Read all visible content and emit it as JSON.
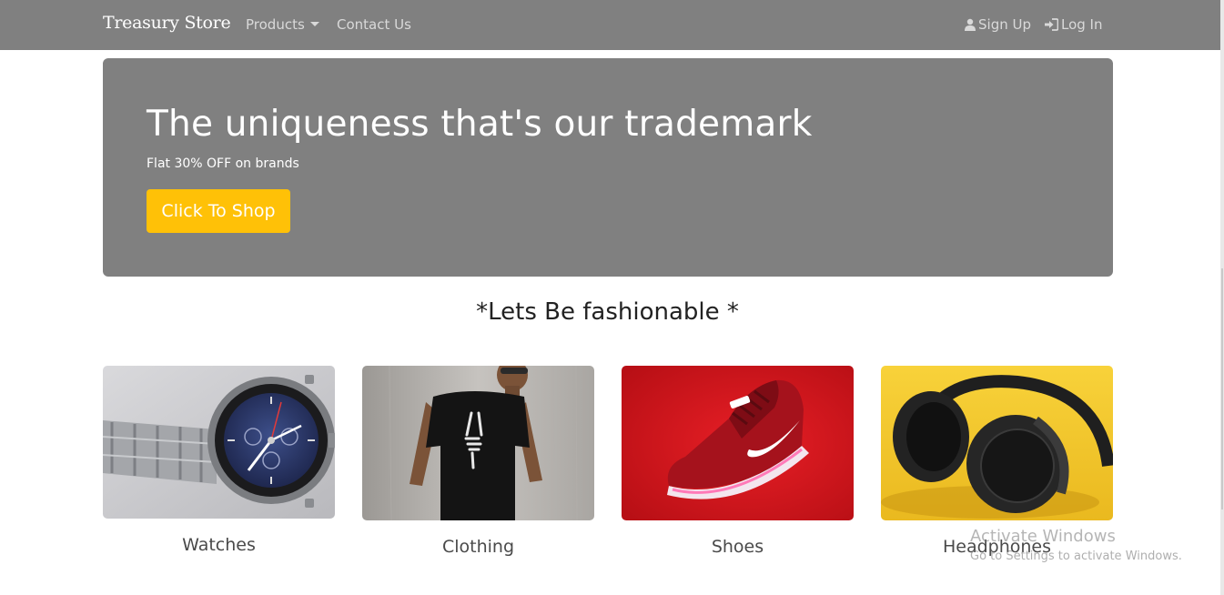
{
  "navbar": {
    "brand": "Treasury Store",
    "products_label": "Products",
    "contact_label": "Contact Us",
    "signup_label": "Sign Up",
    "login_label": "Log In"
  },
  "hero": {
    "title": "The uniqueness that's our trademark",
    "subtitle": "Flat 30% OFF on brands",
    "button_label": "Click To Shop"
  },
  "section": {
    "title": "*Lets Be fashionable *"
  },
  "categories": [
    {
      "label": "Watches",
      "image": "wristwatch-photo"
    },
    {
      "label": "Clothing",
      "image": "man-in-black-tshirt-photo"
    },
    {
      "label": "Shoes",
      "image": "red-sneaker-photo"
    },
    {
      "label": "Headphones",
      "image": "black-headphones-photo"
    }
  ],
  "watermark": {
    "title": "Activate Windows",
    "subtitle": "Go to Settings to activate Windows."
  },
  "colors": {
    "navbar_bg": "#808080",
    "hero_bg": "#808080",
    "button_bg": "#ffc107",
    "shoes_bg": "#d4141d",
    "headphones_bg": "#f6ca2c"
  }
}
